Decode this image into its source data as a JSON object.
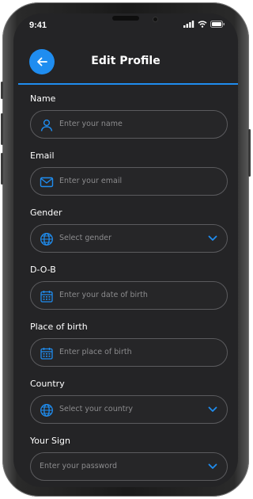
{
  "status_bar": {
    "time": "9:41"
  },
  "header": {
    "title": "Edit Profile"
  },
  "form": {
    "fields": [
      {
        "label": "Name",
        "placeholder": "Enter your name",
        "icon": "person-icon"
      },
      {
        "label": "Email",
        "placeholder": "Enter your email",
        "icon": "mail-icon"
      },
      {
        "label": "Gender",
        "placeholder": "Select gender",
        "icon": "globe-icon",
        "dropdown": true
      },
      {
        "label": "D-O-B",
        "placeholder": "Enter your date of birth",
        "icon": "calendar-icon"
      },
      {
        "label": "Place of birth",
        "placeholder": "Enter place of birth",
        "icon": "calendar-icon"
      },
      {
        "label": "Country",
        "placeholder": "Select your country",
        "icon": "globe-icon",
        "dropdown": true
      },
      {
        "label": "Your Sign",
        "placeholder": "Enter your password",
        "dropdown": true
      }
    ]
  },
  "colors": {
    "accent": "#1f8df0",
    "background": "#242426",
    "border": "#5b5b5e",
    "placeholder": "#8c8c8e"
  }
}
